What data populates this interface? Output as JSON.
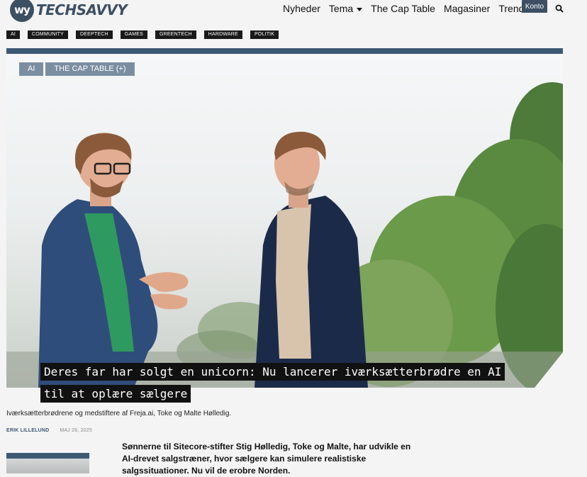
{
  "brand": {
    "mark": "wy",
    "name": "TECHSAVVY"
  },
  "nav": {
    "items": [
      {
        "label": "Nyheder"
      },
      {
        "label": "Tema",
        "has_dropdown": true
      },
      {
        "label": "The Cap Table"
      },
      {
        "label": "Magasiner"
      },
      {
        "label": "Trends"
      }
    ],
    "account_label": "Konto",
    "search_icon": "search-icon"
  },
  "tags": [
    "AI",
    "COMMUNITY",
    "DEEPTECH",
    "GAMES",
    "GREENTECH",
    "HARDWARE",
    "POLITIK"
  ],
  "article": {
    "hero_tags": [
      "AI",
      "THE CAP TABLE (+)"
    ],
    "headline": "Deres far har solgt en unicorn: Nu lancerer iværksætterbrødre en AI til at oplære sælgere",
    "caption": "Iværksætterbrødrene og medstiftere af Freja.ai, Toke og Malte Hølledig.",
    "author": "ERIK LILLELUND",
    "date": "MAJ 26, 2025",
    "lead": "Sønnerne til Sitecore-stifter Stig Hølledig, Toke og Malte, har  udvikle en AI-drevet salgstræner, hvor sælgere kan simulere realistiske salgssituationer. Nu vil de erobre Norden."
  },
  "colors": {
    "brand": "#3d4f63",
    "accent": "#3d5a75",
    "hero_tag": "#7b8ea1",
    "tag_bg": "#1a1a1a"
  }
}
